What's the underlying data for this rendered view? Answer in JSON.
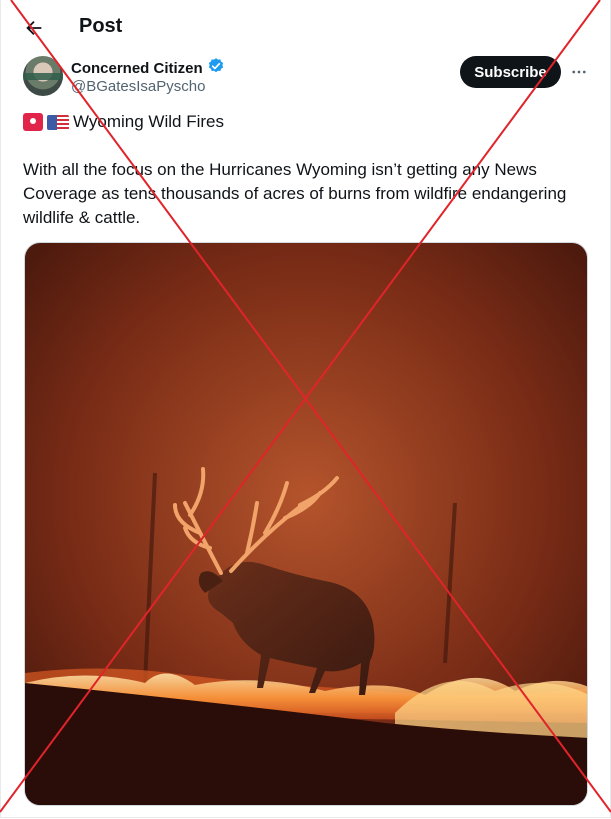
{
  "header": {
    "title": "Post",
    "back_icon": "arrow-left-icon"
  },
  "author": {
    "display_name": "Concerned Citizen",
    "handle": "@BGatesIsaPyscho",
    "verified_badge_color": "#1d9bf0"
  },
  "subscribe_label": "Subscribe",
  "more_icon": "more-horizontal-icon",
  "post": {
    "emoji_line": [
      "police-light-emoji",
      "us-flag-emoji"
    ],
    "headline": "Wyoming Wild Fires",
    "text": "With all the focus on the Hurricanes Wyoming isn’t getting any News Coverage as tens thousands of acres of burns from wildfire endangering wildlife & cattle."
  },
  "media": {
    "description_icon": "video-still-elk-fire"
  },
  "overlay": {
    "color": "#e0242a"
  }
}
